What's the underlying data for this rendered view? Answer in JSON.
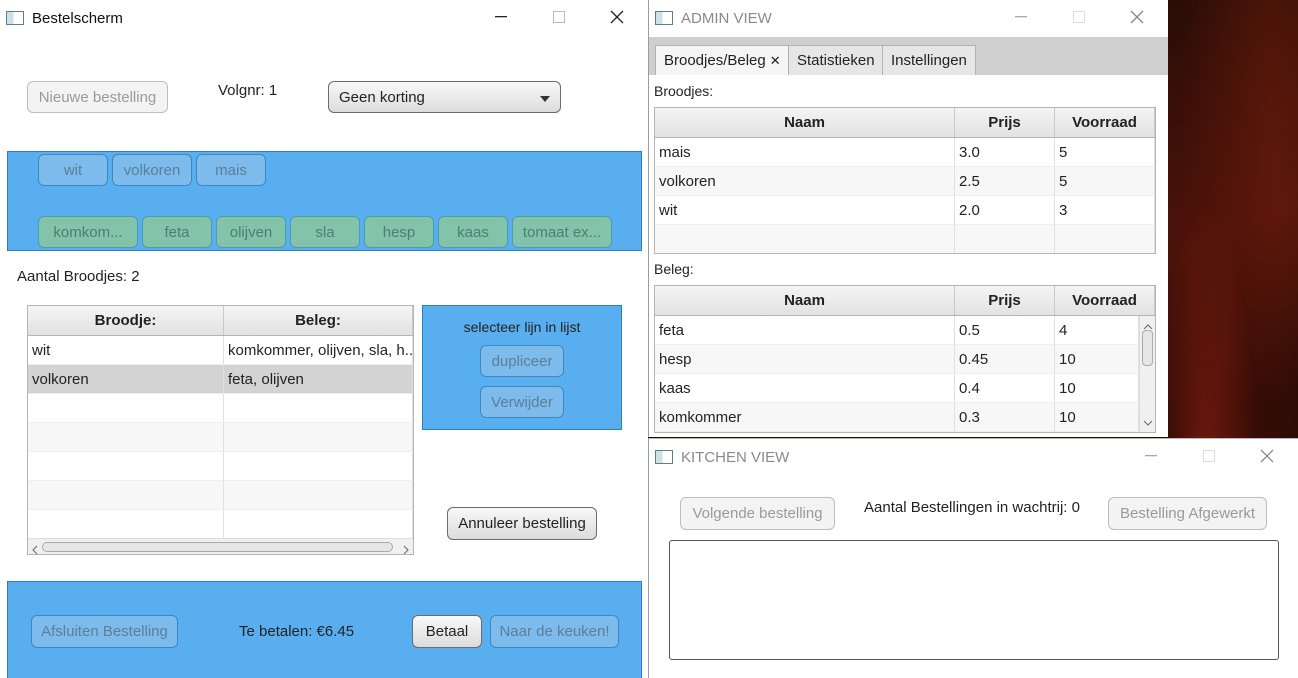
{
  "bestel": {
    "window_title": "Bestelscherm",
    "new_order_btn": "Nieuwe bestelling",
    "volgnr": "Volgnr: 1",
    "discount_selected": "Geen korting",
    "bread_buttons": [
      "wit",
      "volkoren",
      "mais"
    ],
    "topping_buttons": [
      "komkom...",
      "feta",
      "olijven",
      "sla",
      "hesp",
      "kaas",
      "tomaat ex..."
    ],
    "aantal_broodjes": "Aantal Broodjes: 2",
    "table": {
      "headers": [
        "Broodje:",
        "Beleg:"
      ],
      "rows": [
        [
          "wit",
          "komkommer, olijven, sla, h..."
        ],
        [
          "volkoren",
          "feta, olijven"
        ]
      ]
    },
    "select_hint": "selecteer lijn in lijst",
    "duplicate_btn": "dupliceer",
    "remove_btn": "Verwijder",
    "cancel_order_btn": "Annuleer bestelling",
    "close_order_btn": "Afsluiten Bestelling",
    "to_pay": "Te betalen: €6.45",
    "pay_btn": "Betaal",
    "to_kitchen_btn": "Naar de keuken!"
  },
  "admin": {
    "window_title": "ADMIN VIEW",
    "tabs": [
      "Broodjes/Beleg",
      "Statistieken",
      "Instellingen"
    ],
    "tab_close": "✕",
    "broodjes_label": "Broodjes:",
    "broodjes_headers": [
      "Naam",
      "Prijs",
      "Voorraad"
    ],
    "broodjes_rows": [
      [
        "mais",
        "3.0",
        "5"
      ],
      [
        "volkoren",
        "2.5",
        "5"
      ],
      [
        "wit",
        "2.0",
        "3"
      ]
    ],
    "beleg_label": "Beleg:",
    "beleg_headers": [
      "Naam",
      "Prijs",
      "Voorraad"
    ],
    "beleg_rows": [
      [
        "feta",
        "0.5",
        "4"
      ],
      [
        "hesp",
        "0.45",
        "10"
      ],
      [
        "kaas",
        "0.4",
        "10"
      ],
      [
        "komkommer",
        "0.3",
        "10"
      ]
    ]
  },
  "kitchen": {
    "window_title": "KITCHEN VIEW",
    "next_order_btn": "Volgende bestelling",
    "queue_text": "Aantal Bestellingen in wachtrij: 0",
    "order_done_btn": "Bestelling Afgewerkt"
  },
  "colors": {
    "panel_blue": "#59aef0",
    "topping_green": "#82c3a9"
  }
}
